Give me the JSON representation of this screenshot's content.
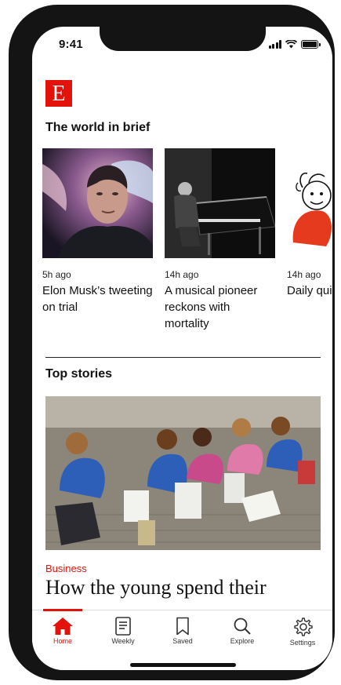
{
  "status": {
    "time": "9:41"
  },
  "brand": {
    "logo_letter": "E",
    "color": "#e3120b"
  },
  "brief": {
    "title": "The world in brief",
    "items": [
      {
        "time": "5h ago",
        "headline": "Elon Musk’s tweeting on trial"
      },
      {
        "time": "14h ago",
        "headline": "A musical pioneer reckons with mortality"
      },
      {
        "time": "14h ago",
        "headline": "Daily quiz"
      }
    ]
  },
  "top": {
    "title": "Top stories",
    "category": "Business",
    "headline": "How the young spend their"
  },
  "tabs": [
    {
      "label": "Home",
      "icon": "home-icon",
      "active": true
    },
    {
      "label": "Weekly",
      "icon": "newspaper-icon"
    },
    {
      "label": "Saved",
      "icon": "bookmark-icon"
    },
    {
      "label": "Explore",
      "icon": "search-icon"
    },
    {
      "label": "Settings",
      "icon": "gear-icon"
    }
  ]
}
